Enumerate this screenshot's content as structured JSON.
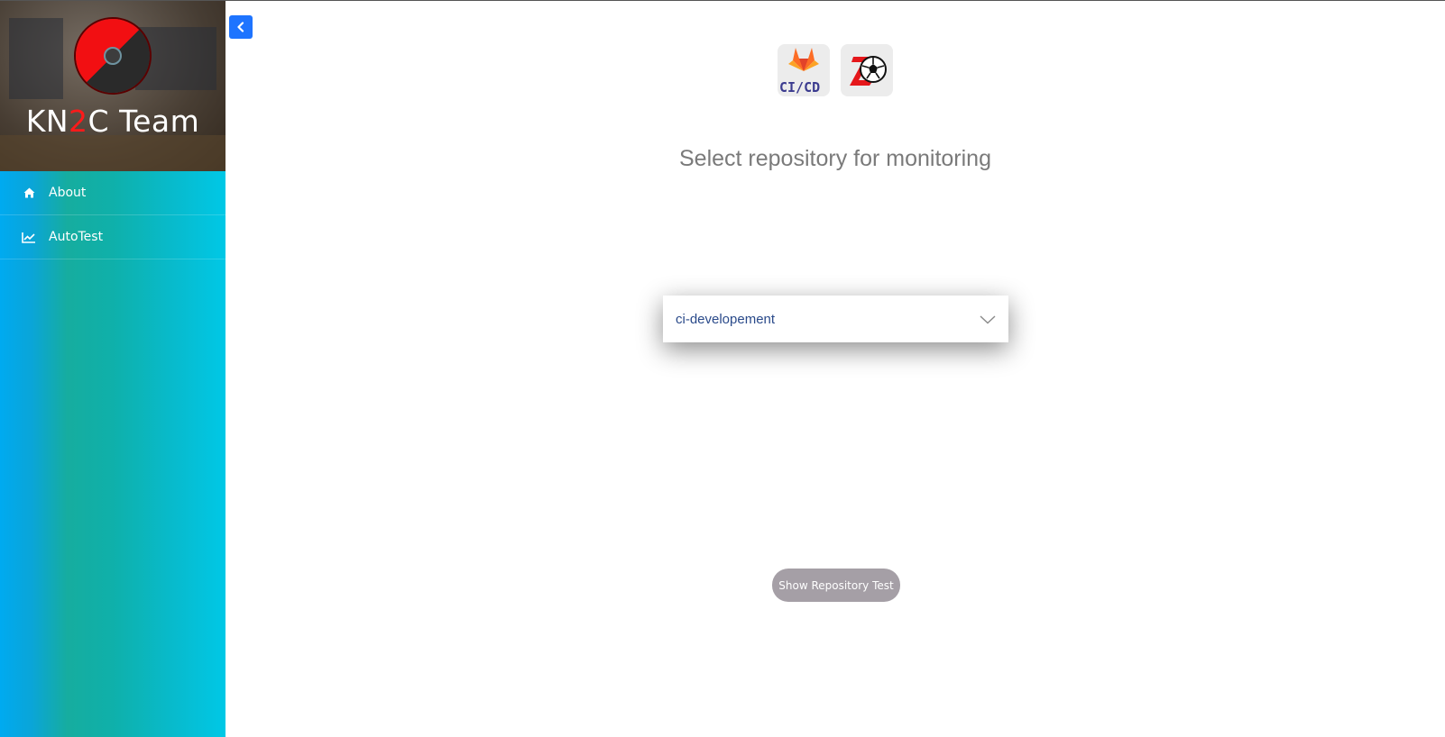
{
  "sidebar": {
    "team_name_prefix": "KN",
    "team_name_accent": "2",
    "team_name_suffix": "C Team",
    "items": [
      {
        "label": "About",
        "icon": "home-icon"
      },
      {
        "label": "AutoTest",
        "icon": "line-chart-icon"
      }
    ]
  },
  "main": {
    "logos": [
      {
        "name": "gitlab-cicd-logo",
        "text": "CI/CD"
      },
      {
        "name": "kn2c-soccer-logo"
      }
    ],
    "title": "Select repository for monitoring",
    "repository_select": {
      "value": "ci-developement"
    },
    "show_button_label": "Show Repository Test"
  },
  "colors": {
    "accent_blue": "#1e74ff",
    "brand_red": "#ff1a1a",
    "button_gray": "#a59fa6"
  }
}
